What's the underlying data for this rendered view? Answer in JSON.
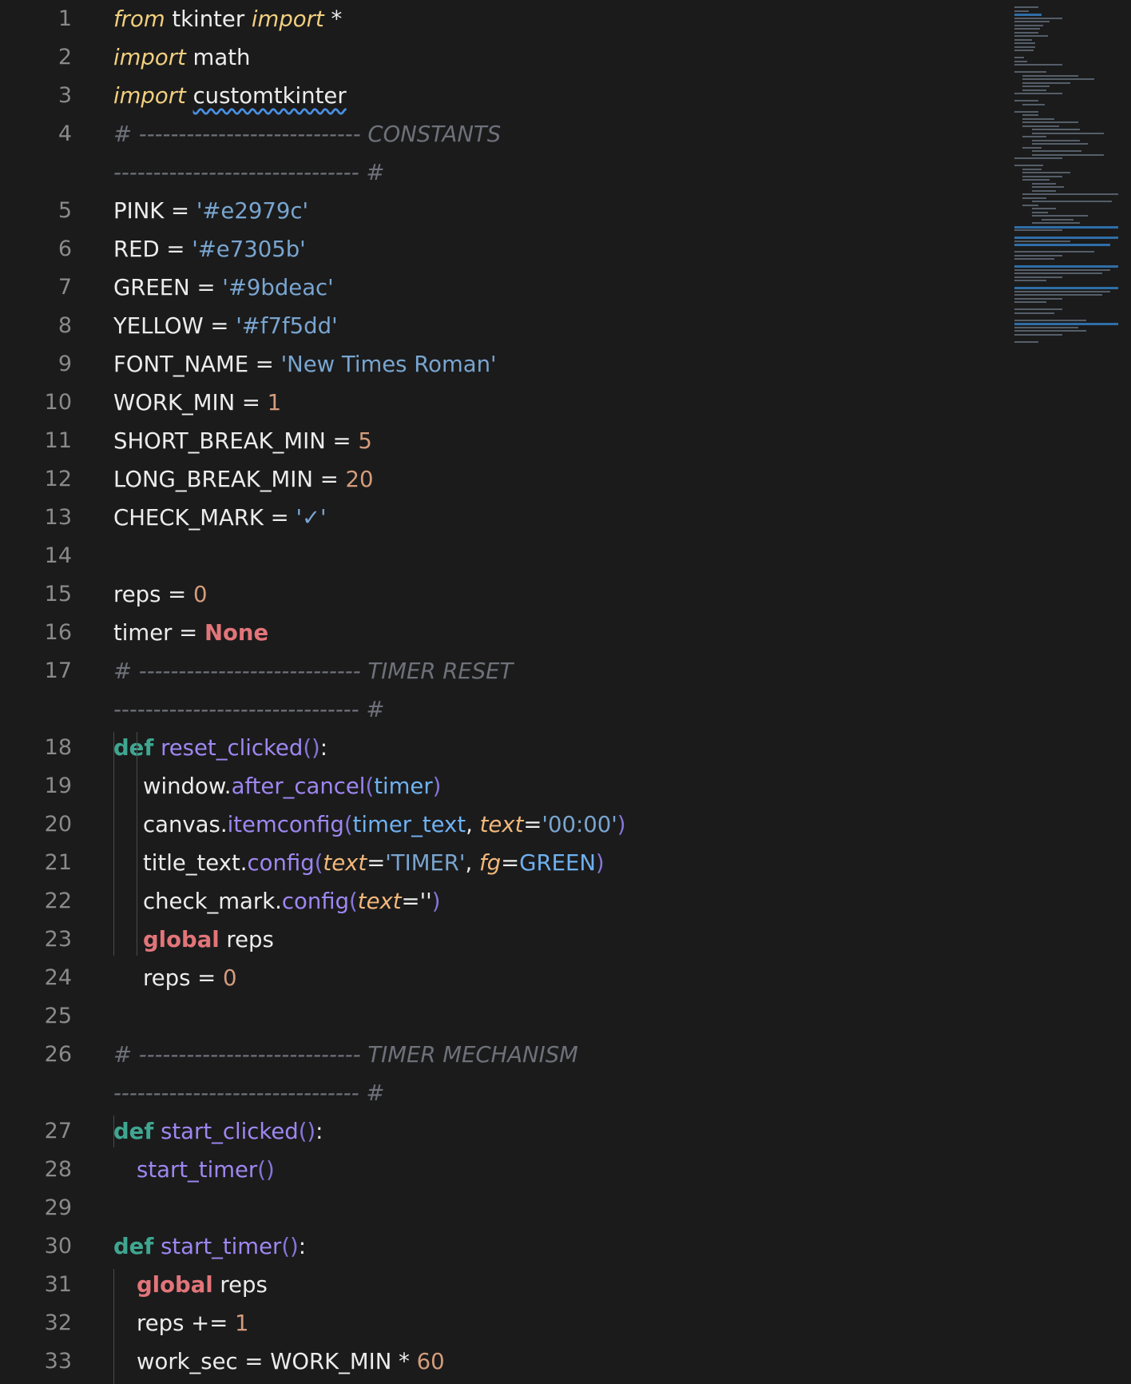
{
  "editor": {
    "lines": [
      {
        "n": "1",
        "indent": 0,
        "tokens": [
          {
            "t": "from",
            "c": "kw-it"
          },
          {
            "t": " tkinter ",
            "c": ""
          },
          {
            "t": "import",
            "c": "kw-it"
          },
          {
            "t": " *",
            "c": ""
          }
        ]
      },
      {
        "n": "2",
        "indent": 0,
        "tokens": [
          {
            "t": "import",
            "c": "kw-it"
          },
          {
            "t": " math",
            "c": ""
          }
        ]
      },
      {
        "n": "3",
        "indent": 0,
        "tokens": [
          {
            "t": "import",
            "c": "kw-it"
          },
          {
            "t": " ",
            "c": ""
          },
          {
            "t": "customtkinter",
            "c": "squiggle"
          }
        ]
      },
      {
        "n": "4",
        "indent": 0,
        "tokens": [
          {
            "t": "# ---------------------------- CONSTANTS",
            "c": "cmt"
          }
        ]
      },
      {
        "n": "",
        "indent": 0,
        "tokens": [
          {
            "t": "------------------------------- #",
            "c": "cmt"
          }
        ]
      },
      {
        "n": "5",
        "indent": 0,
        "tokens": [
          {
            "t": "PINK = ",
            "c": ""
          },
          {
            "t": "'#e2979c'",
            "c": "str"
          }
        ]
      },
      {
        "n": "6",
        "indent": 0,
        "tokens": [
          {
            "t": "RED = ",
            "c": ""
          },
          {
            "t": "'#e7305b'",
            "c": "str"
          }
        ]
      },
      {
        "n": "7",
        "indent": 0,
        "tokens": [
          {
            "t": "GREEN = ",
            "c": ""
          },
          {
            "t": "'#9bdeac'",
            "c": "str"
          }
        ]
      },
      {
        "n": "8",
        "indent": 0,
        "tokens": [
          {
            "t": "YELLOW = ",
            "c": ""
          },
          {
            "t": "'#f7f5dd'",
            "c": "str"
          }
        ]
      },
      {
        "n": "9",
        "indent": 0,
        "tokens": [
          {
            "t": "FONT_NAME = ",
            "c": ""
          },
          {
            "t": "'New Times Roman'",
            "c": "str"
          }
        ]
      },
      {
        "n": "10",
        "indent": 0,
        "tokens": [
          {
            "t": "WORK_MIN = ",
            "c": ""
          },
          {
            "t": "1",
            "c": "num"
          }
        ]
      },
      {
        "n": "11",
        "indent": 0,
        "tokens": [
          {
            "t": "SHORT_BREAK_MIN = ",
            "c": ""
          },
          {
            "t": "5",
            "c": "num"
          }
        ]
      },
      {
        "n": "12",
        "indent": 0,
        "tokens": [
          {
            "t": "LONG_BREAK_MIN = ",
            "c": ""
          },
          {
            "t": "20",
            "c": "num"
          }
        ]
      },
      {
        "n": "13",
        "indent": 0,
        "tokens": [
          {
            "t": "CHECK_MARK = ",
            "c": ""
          },
          {
            "t": "'✓'",
            "c": "str"
          }
        ]
      },
      {
        "n": "14",
        "indent": 0,
        "tokens": []
      },
      {
        "n": "15",
        "indent": 0,
        "tokens": [
          {
            "t": "reps = ",
            "c": ""
          },
          {
            "t": "0",
            "c": "num"
          }
        ]
      },
      {
        "n": "16",
        "indent": 0,
        "tokens": [
          {
            "t": "timer = ",
            "c": ""
          },
          {
            "t": "None",
            "c": "none"
          }
        ]
      },
      {
        "n": "17",
        "indent": 0,
        "tokens": [
          {
            "t": "# ---------------------------- TIMER RESET",
            "c": "cmt"
          }
        ]
      },
      {
        "n": "",
        "indent": 0,
        "tokens": [
          {
            "t": "------------------------------- #",
            "c": "cmt"
          }
        ]
      },
      {
        "n": "18",
        "indent": 0,
        "tokens": [
          {
            "t": "def",
            "c": "def"
          },
          {
            "t": " ",
            "c": ""
          },
          {
            "t": "reset_clicked",
            "c": "fn"
          },
          {
            "t": "()",
            "c": "paren"
          },
          {
            "t": ":",
            "c": ""
          }
        ]
      },
      {
        "n": "19",
        "indent": 2,
        "tokens": [
          {
            "t": "window.",
            "c": ""
          },
          {
            "t": "after_cancel",
            "c": "fn"
          },
          {
            "t": "(",
            "c": "paren"
          },
          {
            "t": "timer",
            "c": "param"
          },
          {
            "t": ")",
            "c": "paren"
          }
        ]
      },
      {
        "n": "20",
        "indent": 2,
        "tokens": [
          {
            "t": "canvas.",
            "c": ""
          },
          {
            "t": "itemconfig",
            "c": "fn"
          },
          {
            "t": "(",
            "c": "paren"
          },
          {
            "t": "timer_text",
            "c": "param"
          },
          {
            "t": ", ",
            "c": ""
          },
          {
            "t": "text",
            "c": "kwarg"
          },
          {
            "t": "=",
            "c": ""
          },
          {
            "t": "'00:00'",
            "c": "str"
          },
          {
            "t": ")",
            "c": "paren"
          }
        ]
      },
      {
        "n": "21",
        "indent": 2,
        "tokens": [
          {
            "t": "title_text.",
            "c": ""
          },
          {
            "t": "config",
            "c": "fn"
          },
          {
            "t": "(",
            "c": "paren"
          },
          {
            "t": "text",
            "c": "kwarg"
          },
          {
            "t": "=",
            "c": ""
          },
          {
            "t": "'TIMER'",
            "c": "str"
          },
          {
            "t": ", ",
            "c": ""
          },
          {
            "t": "fg",
            "c": "kwarg"
          },
          {
            "t": "=",
            "c": ""
          },
          {
            "t": "GREEN",
            "c": "param"
          },
          {
            "t": ")",
            "c": "paren"
          }
        ]
      },
      {
        "n": "22",
        "indent": 2,
        "tokens": [
          {
            "t": "check_mark.",
            "c": ""
          },
          {
            "t": "config",
            "c": "fn"
          },
          {
            "t": "(",
            "c": "paren"
          },
          {
            "t": "text",
            "c": "kwarg"
          },
          {
            "t": "=''",
            "c": ""
          },
          {
            "t": ")",
            "c": "paren"
          }
        ]
      },
      {
        "n": "23",
        "indent": 2,
        "tokens": [
          {
            "t": "global",
            "c": "global"
          },
          {
            "t": " reps",
            "c": ""
          }
        ]
      },
      {
        "n": "24",
        "indent": 2,
        "tokens": [
          {
            "t": "reps = ",
            "c": ""
          },
          {
            "t": "0",
            "c": "num"
          }
        ]
      },
      {
        "n": "25",
        "indent": 0,
        "tokens": []
      },
      {
        "n": "26",
        "indent": 0,
        "tokens": [
          {
            "t": "# ---------------------------- TIMER MECHANISM",
            "c": "cmt"
          }
        ]
      },
      {
        "n": "",
        "indent": 0,
        "tokens": [
          {
            "t": "------------------------------- #",
            "c": "cmt"
          }
        ]
      },
      {
        "n": "27",
        "indent": 0,
        "tokens": [
          {
            "t": "def",
            "c": "def"
          },
          {
            "t": " ",
            "c": ""
          },
          {
            "t": "start_clicked",
            "c": "fn"
          },
          {
            "t": "()",
            "c": "paren"
          },
          {
            "t": ":",
            "c": ""
          }
        ]
      },
      {
        "n": "28",
        "indent": 1,
        "tokens": [
          {
            "t": "start_timer",
            "c": "fn"
          },
          {
            "t": "()",
            "c": "paren"
          }
        ]
      },
      {
        "n": "29",
        "indent": 0,
        "tokens": []
      },
      {
        "n": "30",
        "indent": 0,
        "tokens": [
          {
            "t": "def",
            "c": "def"
          },
          {
            "t": " ",
            "c": ""
          },
          {
            "t": "start_timer",
            "c": "fn"
          },
          {
            "t": "()",
            "c": "paren"
          },
          {
            "t": ":",
            "c": ""
          }
        ]
      },
      {
        "n": "31",
        "indent": 1,
        "tokens": [
          {
            "t": "global",
            "c": "global"
          },
          {
            "t": " reps",
            "c": ""
          }
        ]
      },
      {
        "n": "32",
        "indent": 1,
        "tokens": [
          {
            "t": "reps += ",
            "c": ""
          },
          {
            "t": "1",
            "c": "num"
          }
        ]
      },
      {
        "n": "33",
        "indent": 1,
        "tokens": [
          {
            "t": "work_sec = WORK_MIN ",
            "c": ""
          },
          {
            "t": "*",
            "c": ""
          },
          {
            "t": " ",
            "c": ""
          },
          {
            "t": "60",
            "c": "num"
          }
        ]
      }
    ]
  }
}
